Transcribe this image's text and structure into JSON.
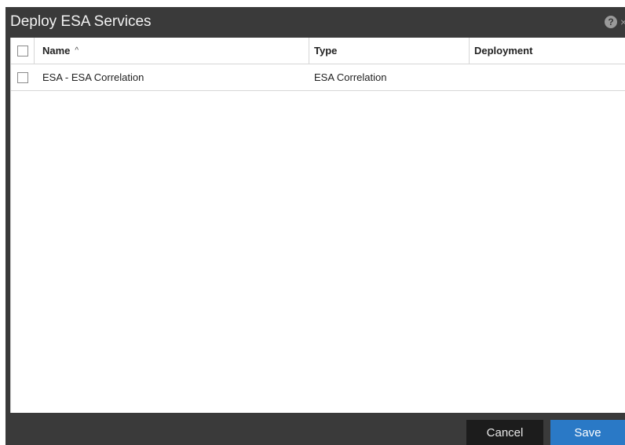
{
  "dialog": {
    "title": "Deploy ESA Services",
    "help_icon_glyph": "?",
    "close_icon_glyph": "×"
  },
  "grid": {
    "columns": {
      "name": "Name",
      "name_sort_indicator": "^",
      "type": "Type",
      "deployment": "Deployment"
    },
    "rows": [
      {
        "name": "ESA - ESA Correlation",
        "type": "ESA Correlation",
        "deployment": ""
      }
    ]
  },
  "footer": {
    "cancel_label": "Cancel",
    "save_label": "Save"
  },
  "colors": {
    "dialog_bg": "#3a3a3a",
    "save_button": "#2a79c6",
    "cancel_button": "#1c1c1c"
  },
  "icons": [
    "help-icon",
    "close-icon",
    "sort-ascending-icon"
  ]
}
